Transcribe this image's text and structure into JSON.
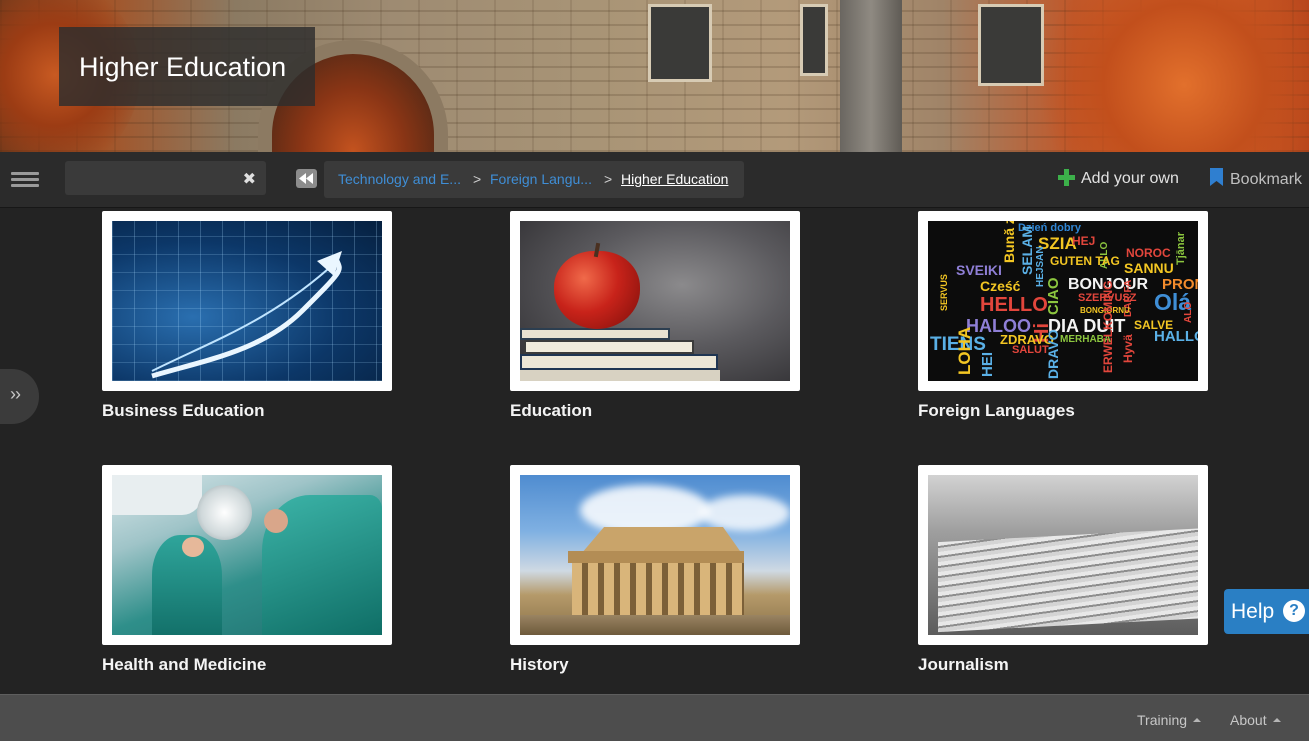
{
  "banner": {
    "title": "Higher Education"
  },
  "toolbar": {
    "search": {
      "value": "",
      "placeholder": ""
    },
    "breadcrumbs": [
      {
        "label": "Technology and E..."
      },
      {
        "label": "Foreign Langu..."
      },
      {
        "label": "Higher Education"
      }
    ],
    "separator": ">",
    "add_your_own": "Add your own",
    "bookmark": "Bookmark"
  },
  "categories": [
    {
      "label": "Business Education",
      "image": "stock-chart-arrow"
    },
    {
      "label": "Education",
      "image": "apple-on-books"
    },
    {
      "label": "Foreign Languages",
      "image": "hello-word-cloud"
    },
    {
      "label": "Health and Medicine",
      "image": "surgeons-operating-room"
    },
    {
      "label": "History",
      "image": "parthenon-ruins"
    },
    {
      "label": "Journalism",
      "image": "newspaper-stack"
    }
  ],
  "word_cloud": [
    "Dzień dobry",
    "SZIA",
    "Bună ziua",
    "SELAM",
    "HEJ",
    "ALLO",
    "NOROC",
    "SANNU",
    "Tjānar",
    "SVEIKI",
    "GUTEN TAG",
    "HEJSAN",
    "Cześć",
    "BONJOUR",
    "PRONTO",
    "SERVUS",
    "HELLO",
    "CIAO",
    "SZERVUSZ",
    "DAR FA",
    "Olá",
    "ALO",
    "BONGIORNU",
    "HALOO",
    "Hi",
    "DIA DUIT",
    "SALVE",
    "HALLO",
    "TIENS",
    "ZDRAVO",
    "MERHABA",
    "Hyvä",
    "LOHA",
    "HEI",
    "SALUT",
    "DRAVO",
    "ERWELKOMING"
  ],
  "help": {
    "label": "Help",
    "icon_text": "?"
  },
  "footer": {
    "training": "Training",
    "about": "About"
  },
  "colors": {
    "link": "#3f8ed6",
    "help_blue": "#2a7fc4",
    "add_green": "#3cb04a",
    "bookmark_blue": "#2f7fd0"
  }
}
